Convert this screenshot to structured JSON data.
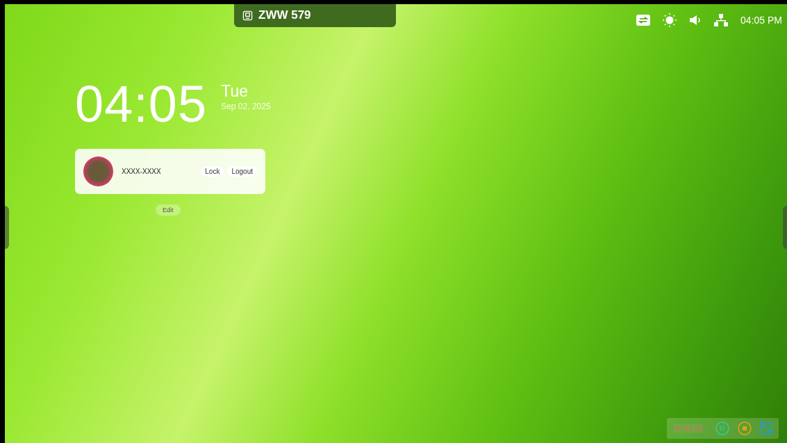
{
  "top_badge": {
    "label": "ZWW 579"
  },
  "status_bar": {
    "time": "04:05 PM"
  },
  "clock": {
    "time": "04:05",
    "weekday": "Tue",
    "date": "Sep 02, 2025"
  },
  "user_card": {
    "name": "XXXX-XXXX",
    "buttons": [
      "Lock",
      "Logout"
    ]
  },
  "edit_button": "Edit",
  "recorder": {
    "elapsed": "00:03:00"
  }
}
